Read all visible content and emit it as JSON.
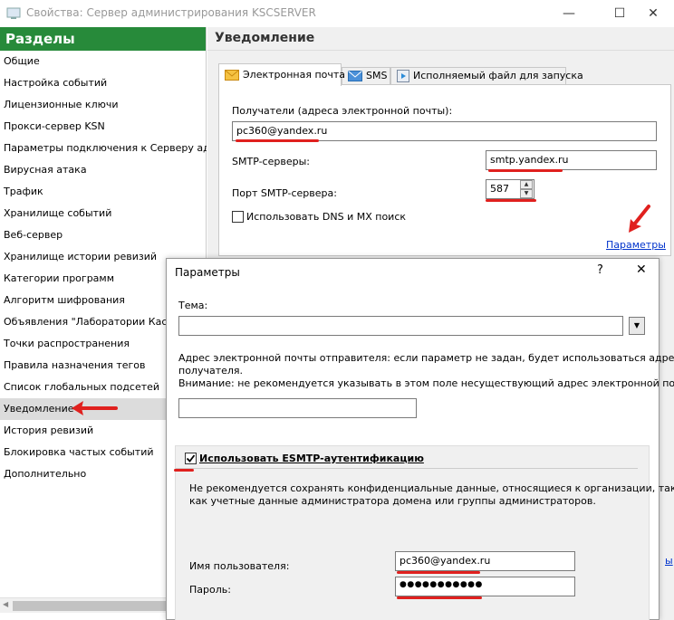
{
  "window": {
    "title": "Свойства: Сервер администрирования KSCSERVER",
    "minimize_glyph": "—",
    "maximize_glyph": "☐",
    "close_glyph": "✕"
  },
  "sections": {
    "header": "Разделы",
    "items": [
      "Общие",
      "Настройка событий",
      "Лицензионные ключи",
      "Прокси-сервер KSN",
      "Параметры подключения к Серверу админи",
      "Вирусная атака",
      "Трафик",
      "Хранилище событий",
      "Веб-сервер",
      "Хранилище истории ревизий",
      "Категории программ",
      "Алгоритм шифрования",
      "Объявления \"Лаборатории Касперс",
      "Точки распространения",
      "Правила назначения тегов",
      "Список глобальных подсетей",
      "Уведомление",
      "История ревизий",
      "Блокировка частых событий",
      "Дополнительно"
    ],
    "selected_index": 16
  },
  "notification": {
    "header": "Уведомление",
    "tabs": [
      "Электронная почта",
      "SMS",
      "Исполняемый файл для запуска"
    ],
    "active_tab": 0,
    "recipients_label": "Получатели (адреса электронной почты):",
    "recipients_value": "pc360@yandex.ru",
    "smtp_label": "SMTP-серверы:",
    "smtp_value": "smtp.yandex.ru",
    "port_label": "Порт SMTP-сервера:",
    "port_value": "587",
    "dns_label": "Использовать DNS и MX поиск",
    "params_link": "Параметры",
    "partial_link": "ы"
  },
  "dialog": {
    "title": "Параметры",
    "help": "?",
    "close": "✕",
    "subject_label": "Тема:",
    "subject_value": "",
    "sender_note_1": "Адрес электронной почты отправителя: если параметр не задан, будет использоваться адрес",
    "sender_note_2": "получателя.",
    "sender_note_3": "Внимание: не рекомендуется указывать в этом поле несуществующий адрес электронной почты.",
    "sender_value": "",
    "esmtp_label": "Использовать ESMTP-аутентификацию",
    "esmtp_checked": true,
    "esmtp_note_1": "Не рекомендуется сохранять конфиденциальные данные, относящиеся к организации, такие",
    "esmtp_note_2": "как учетные данные администратора домена или группы администраторов.",
    "username_label": "Имя пользователя:",
    "username_value": "pc360@yandex.ru",
    "password_label": "Пароль:",
    "password_value": "●●●●●●●●●●●"
  },
  "colors": {
    "accent_green": "#278a3a",
    "annotation_red": "#e0201e",
    "link_blue": "#0033cc"
  }
}
